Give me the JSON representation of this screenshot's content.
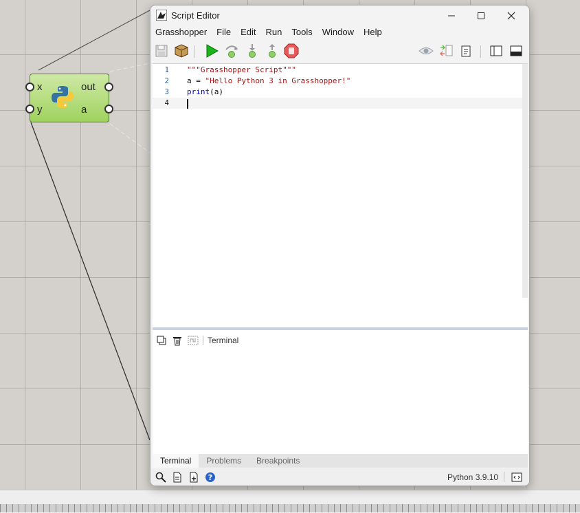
{
  "component": {
    "inputs": [
      "x",
      "y"
    ],
    "outputs": [
      "out",
      "a"
    ]
  },
  "window": {
    "title": "Script Editor",
    "controls": [
      "minimize-icon",
      "maximize-icon",
      "close-icon"
    ]
  },
  "menu": [
    "Grasshopper",
    "File",
    "Edit",
    "Run",
    "Tools",
    "Window",
    "Help"
  ],
  "toolbar_icons": [
    "save-icon",
    "package-icon",
    "run-icon",
    "step-over-icon",
    "step-into-icon",
    "step-out-icon",
    "stop-icon",
    "preview-eye-icon",
    "compare-icon",
    "clipboard-icon",
    "panel-left-icon",
    "panel-bottom-icon"
  ],
  "editor": {
    "lines": [
      {
        "num": "1",
        "text": "\"\"\"Grasshopper Script\"\"\""
      },
      {
        "num": "2",
        "text": "a = \"Hello Python 3 in Grasshopper!\""
      },
      {
        "num": "3",
        "text": "print(a)"
      },
      {
        "num": "4",
        "text": ""
      }
    ],
    "colors": {
      "string": "#a31515",
      "keyword": "#0000cc",
      "linenum": "#2c5a9e"
    }
  },
  "terminal": {
    "label": "Terminal",
    "icons": [
      "copy-icon",
      "trash-icon",
      "wrap-icon"
    ]
  },
  "tabs": [
    {
      "label": "Terminal",
      "active": true
    },
    {
      "label": "Problems",
      "active": false
    },
    {
      "label": "Breakpoints",
      "active": false
    }
  ],
  "status": {
    "version": "Python 3.9.10",
    "icons": [
      "search-icon",
      "new-file-icon",
      "add-file-icon",
      "help-icon",
      "code-toggle-icon"
    ]
  }
}
